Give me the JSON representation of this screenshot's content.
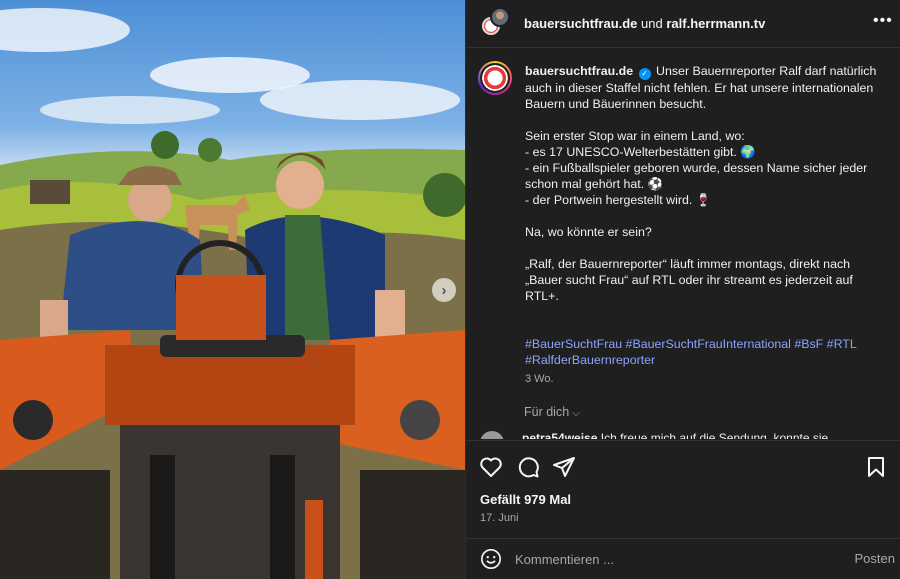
{
  "header": {
    "account_1": "bauersuchtfrau.de",
    "joiner": "und",
    "account_2": "ralf.herrmann.tv"
  },
  "caption": {
    "username": "bauersuchtfrau.de",
    "intro": "Unser Bauernreporter Ralf darf natürlich auch in dieser Staffel nicht fehlen. Er hat unsere internationalen Bauern und Bäuerinnen besucht.",
    "lines": [
      "Sein erster Stop war in einem Land, wo:",
      "- es 17 UNESCO-Welterbestätten gibt. 🌍",
      "- ein Fußballspieler geboren wurde, dessen Name sicher jeder schon mal gehört hat. ⚽",
      "- der Portwein hergestellt wird. 🍷"
    ],
    "question": "Na, wo könnte er sein?",
    "promo": "„Ralf, der Bauernreporter“ läuft immer montags, direkt nach „Bauer sucht Frau“ auf RTL oder ihr streamt es jederzeit auf RTL+.",
    "hashtags": "#BauerSuchtFrau #BauerSuchtFrauInternational #BsF #RTL #RalfderBauernreporter",
    "time_ago": "3 Wo."
  },
  "for_you_label": "Für dich",
  "comment_preview": {
    "user": "petra54weise",
    "text": "Ich freue mich auf die Sendung, konnte sie"
  },
  "actions": {
    "likes": "Gefällt 979 Mal",
    "date": "17. Juni"
  },
  "comment_bar": {
    "placeholder": "Kommentieren ...",
    "post_label": "Posten"
  },
  "icons": [
    "heart-icon",
    "comment-icon",
    "share-icon",
    "bookmark-icon",
    "emoji-icon",
    "more-icon",
    "chevron-right-icon",
    "verified-icon"
  ],
  "colors": {
    "panel_bg": "#1f1f1f",
    "hashtag": "#8ba5ff",
    "verified": "#0095f6",
    "muted": "#a8a8a8"
  }
}
